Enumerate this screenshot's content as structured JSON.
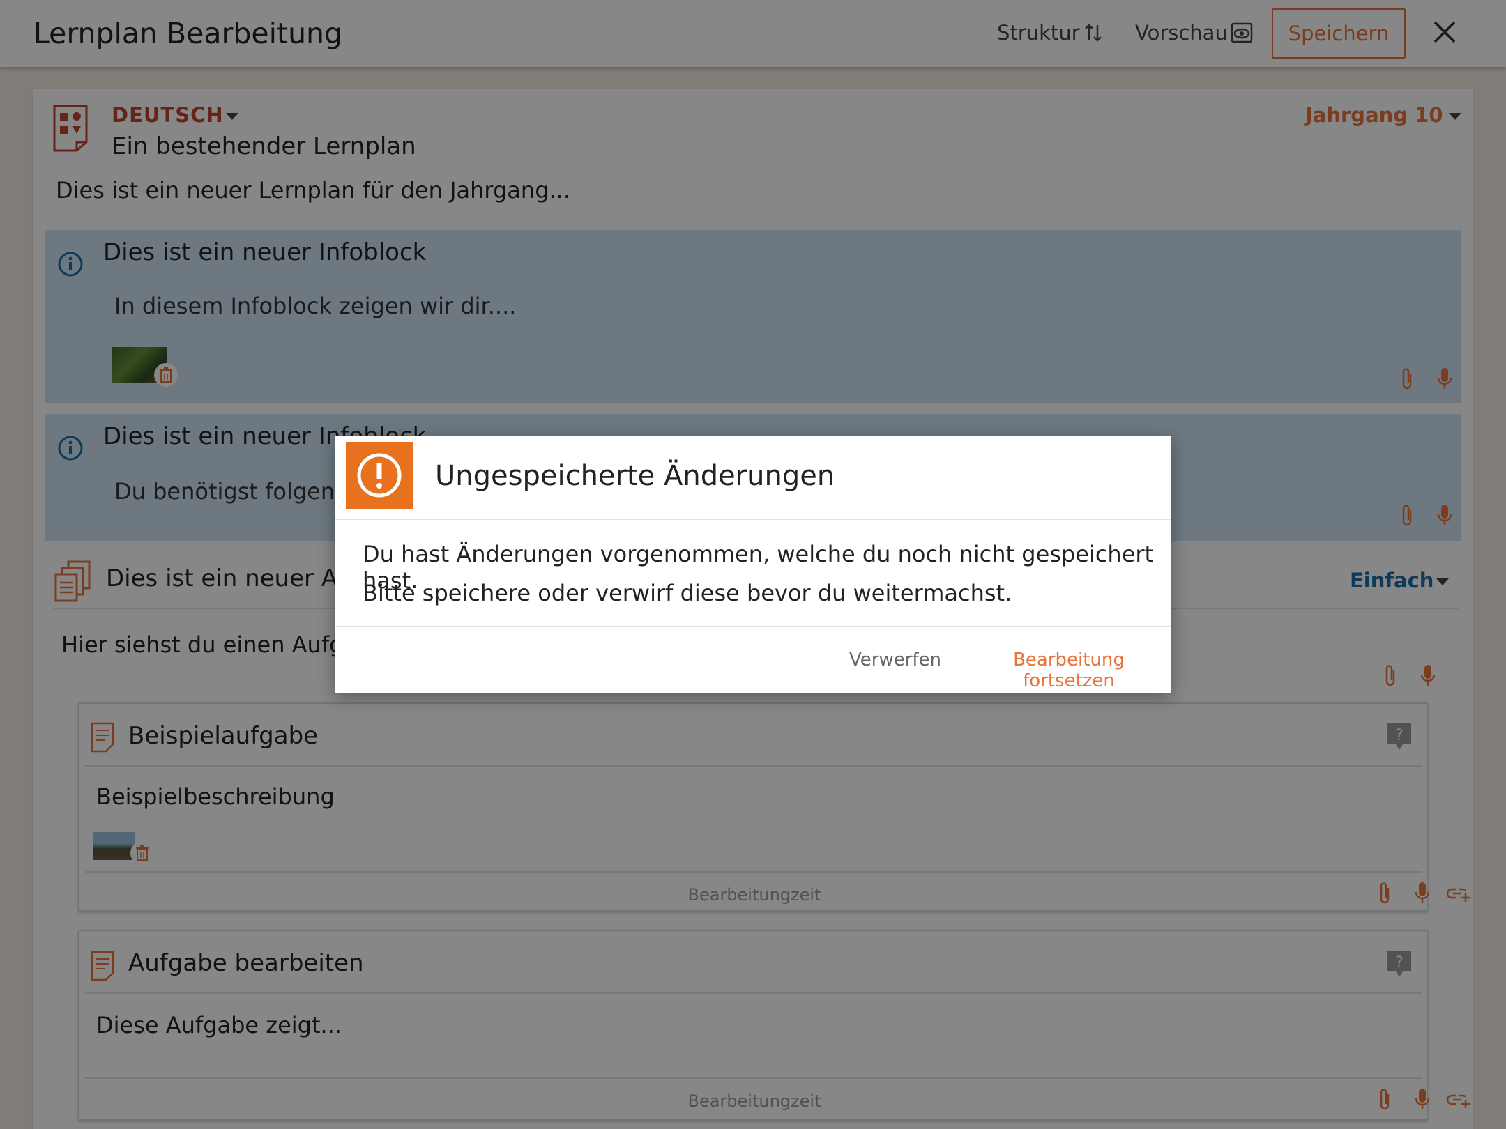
{
  "header": {
    "title": "Lernplan Bearbeitung",
    "structure_label": "Struktur",
    "preview_label": "Vorschau",
    "save_label": "Speichern"
  },
  "plan": {
    "subject": "DEUTSCH",
    "title": "Ein bestehender Lernplan",
    "grade": "Jahrgang 10",
    "description": "Dies ist ein neuer Lernplan für den Jahrgang..."
  },
  "infoblocks": [
    {
      "title": "Dies ist ein neuer Infoblock",
      "text": "In diesem Infoblock zeigen wir dir...."
    },
    {
      "title": "Dies ist ein neuer Infoblock",
      "text": "Du benötigst folgende"
    }
  ],
  "task_section": {
    "title": "Dies ist ein neuer Aufg",
    "difficulty": "Einfach",
    "description": "Hier siehst du einen Aufgab"
  },
  "tasks": [
    {
      "title": "Beispielaufgabe",
      "description": "Beispielbeschreibung",
      "duration_label": "Bearbeitungzeit"
    },
    {
      "title": "Aufgabe bearbeiten",
      "description": "Diese Aufgabe zeigt...",
      "duration_label": "Bearbeitungzeit"
    }
  ],
  "dialog": {
    "title": "Ungespeicherte Änderungen",
    "line1": "Du hast Änderungen vorgenommen, welche du noch nicht gespeichert hast.",
    "line2": "Bitte speichere oder verwirf diese bevor du weitermachst.",
    "discard_label": "Verwerfen",
    "continue_label": "Bearbeitung fortsetzen"
  },
  "colors": {
    "accent": "#e8743b",
    "subject": "#c0432c",
    "info_bg": "#cfe3f2",
    "info_icon": "#1a6ea8",
    "warning": "#e8711e"
  },
  "icons": [
    "sort-arrows-icon",
    "eye-icon",
    "close-icon",
    "subject-icon",
    "info-icon",
    "attachment-icon",
    "microphone-icon",
    "tasks-icon",
    "task-doc-icon",
    "help-icon",
    "link-add-icon",
    "trash-icon",
    "warning-icon"
  ]
}
